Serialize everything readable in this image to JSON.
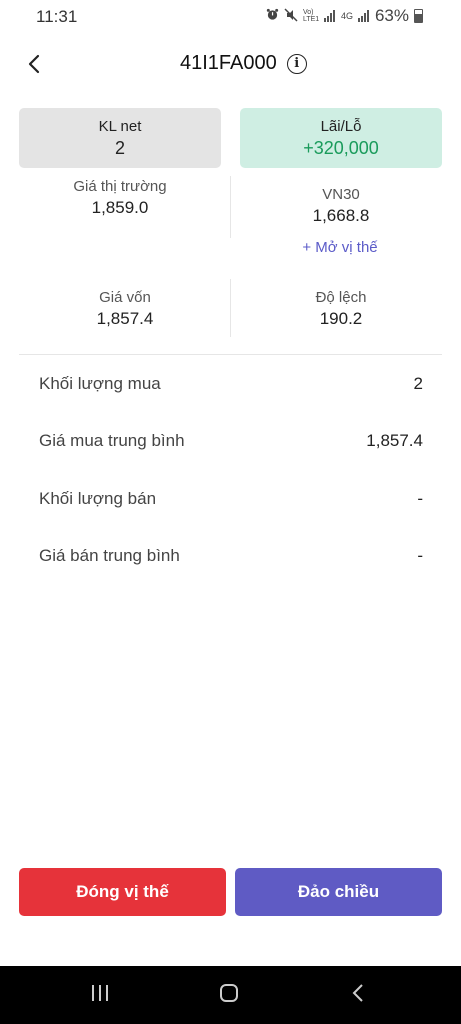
{
  "status": {
    "time": "11:31",
    "network_label": "Vo) LTE1",
    "data_label": "4G",
    "battery": "63%"
  },
  "header": {
    "title": "41I1FA000"
  },
  "cards": {
    "kl_net": {
      "label": "KL net",
      "value": "2"
    },
    "lai_lo": {
      "label": "Lãi/Lỗ",
      "value": "+320,000",
      "color": "#1a9b5b"
    }
  },
  "stats": {
    "market_price": {
      "label": "Giá thị trường",
      "value": "1,859.0"
    },
    "vn30": {
      "label": "VN30",
      "value": "1,668.8"
    },
    "open_position": "+ Mở vị thế",
    "cost_price": {
      "label": "Giá vốn",
      "value": "1,857.4"
    },
    "deviation": {
      "label": "Độ lệch",
      "value": "190.2"
    }
  },
  "details": [
    {
      "label": "Khối lượng mua",
      "value": "2"
    },
    {
      "label": "Giá mua trung bình",
      "value": "1,857.4"
    },
    {
      "label": "Khối lượng bán",
      "value": "-"
    },
    {
      "label": "Giá bán trung bình",
      "value": "-"
    }
  ],
  "actions": {
    "close_position": "Đóng vị thế",
    "reverse": "Đảo chiều"
  },
  "colors": {
    "close_button": "#e6333a",
    "reverse_button": "#5f5bc4",
    "link": "#5b5bc8"
  }
}
